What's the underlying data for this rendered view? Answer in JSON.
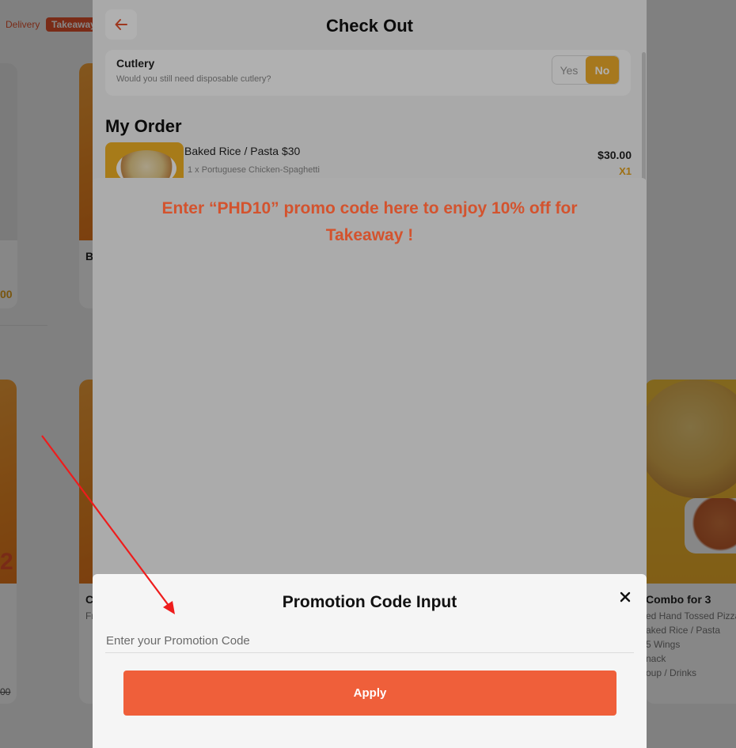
{
  "background": {
    "tabs": {
      "delivery": "Delivery",
      "takeaway": "Takeaway"
    },
    "left_card": {
      "price_partial": "00",
      "strike_partial": "00",
      "big_number_partial": "2"
    },
    "middle_card": {
      "name_partial": "B",
      "name_partial_2": "C",
      "detail_initial": "Fr"
    },
    "right_card": {
      "title": "Combo for 3",
      "lines": [
        "ed Hand Tossed Pizza",
        "aked Rice / Pasta",
        "5 Wings",
        "nack",
        "oup / Drinks"
      ]
    }
  },
  "checkout": {
    "title": "Check Out",
    "cutlery": {
      "title": "Cutlery",
      "subtitle": "Would you still need disposable cutlery?",
      "options": [
        "Yes",
        "No"
      ],
      "selected": "No"
    },
    "my_order": {
      "heading": "My Order",
      "items": [
        {
          "name": "Baked Rice / Pasta $30",
          "detail": "1 x Portuguese Chicken-Spaghetti",
          "price": "$30.00",
          "qty": "X1"
        }
      ]
    }
  },
  "promo_banner": {
    "text": "Enter “PHD10” promo code here to enjoy 10% off for Takeaway !"
  },
  "promo_modal": {
    "title": "Promotion Code Input",
    "input_placeholder": "Enter your Promotion Code",
    "input_value": "",
    "apply_label": "Apply",
    "close_symbol": "✕"
  },
  "colors": {
    "accent": "#ef5f3a",
    "banner_text": "#d3532e",
    "toggle_active": "#f1ae2c",
    "qty": "#e5a21d",
    "arrow": "#ee1c1c"
  },
  "icons": [
    "arrow-left-icon",
    "close-icon"
  ]
}
